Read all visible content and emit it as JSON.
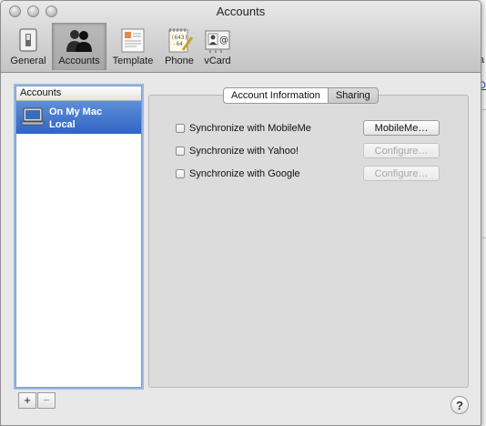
{
  "window": {
    "title": "Accounts"
  },
  "toolbar": {
    "items": [
      {
        "label": "General",
        "icon": "switch-icon"
      },
      {
        "label": "Accounts",
        "icon": "people-icon"
      },
      {
        "label": "Template",
        "icon": "template-icon"
      },
      {
        "label": "Phone",
        "icon": "phone-note-icon"
      },
      {
        "label": "vCard",
        "icon": "vcard-icon"
      }
    ],
    "selected": "Accounts"
  },
  "accounts_list": {
    "header": "Accounts",
    "items": [
      {
        "name": "On My Mac",
        "kind": "Local",
        "icon": "laptop-icon",
        "selected": true
      }
    ]
  },
  "tabs": [
    {
      "label": "Account Information",
      "active": true
    },
    {
      "label": "Sharing",
      "active": false
    }
  ],
  "sync_options": [
    {
      "label": "Synchronize with MobileMe",
      "checked": false,
      "button": "MobileMe…",
      "button_enabled": true
    },
    {
      "label": "Synchronize with Yahoo!",
      "checked": false,
      "button": "Configure…",
      "button_enabled": false
    },
    {
      "label": "Synchronize with Google",
      "checked": false,
      "button": "Configure…",
      "button_enabled": false
    }
  ],
  "footer": {
    "add_label": "+",
    "remove_label": "−",
    "help_label": "?"
  },
  "background_app": {
    "fragments": [
      "a",
      "D"
    ]
  }
}
